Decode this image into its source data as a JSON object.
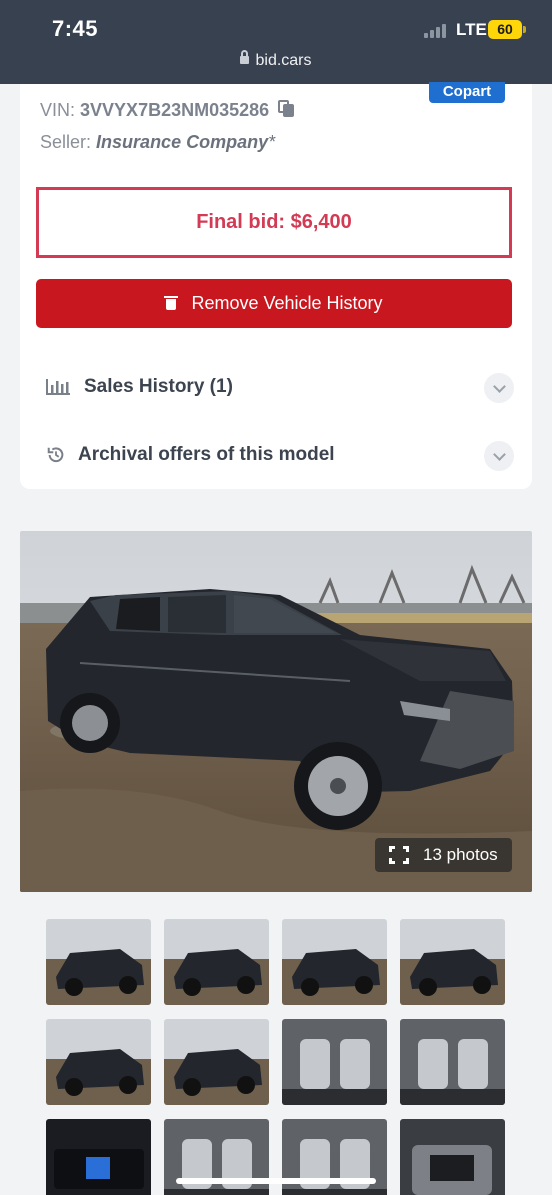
{
  "status_bar": {
    "time": "7:45",
    "network": "LTE",
    "battery": "60"
  },
  "browser": {
    "url": "bid.cars"
  },
  "lot": {
    "auction_badge": "Copart",
    "vin_label": "VIN:",
    "vin": "3VVYX7B23NM035286",
    "seller_label": "Seller:",
    "seller": "Insurance Company",
    "seller_mark": "*",
    "final_bid": "Final bid: $6,400"
  },
  "actions": {
    "remove_history": "Remove Vehicle History"
  },
  "accordions": [
    {
      "label": "Sales History (1)",
      "icon": "bar-chart-icon"
    },
    {
      "label": "Archival offers of this model",
      "icon": "history-icon"
    }
  ],
  "gallery": {
    "photo_count": "13 photos",
    "thumbnails": [
      {
        "icon": "car-front-left-photo"
      },
      {
        "icon": "car-rear-left-photo"
      },
      {
        "icon": "car-rear-left-photo"
      },
      {
        "icon": "car-front-right-photo"
      },
      {
        "icon": "car-front-damage-photo"
      },
      {
        "icon": "car-rear-photo"
      },
      {
        "icon": "interior-front-seats-photo"
      },
      {
        "icon": "interior-dashboard-photo"
      },
      {
        "icon": "instrument-cluster-photo"
      },
      {
        "icon": "interior-rear-seats-photo"
      },
      {
        "icon": "interior-seat-photo"
      },
      {
        "icon": "engine-bay-photo"
      }
    ]
  },
  "colors": {
    "accent_blue": "#1f6fd1",
    "bid_red": "#d33a53",
    "button_red": "#c8171f",
    "header_bg": "#374150"
  }
}
